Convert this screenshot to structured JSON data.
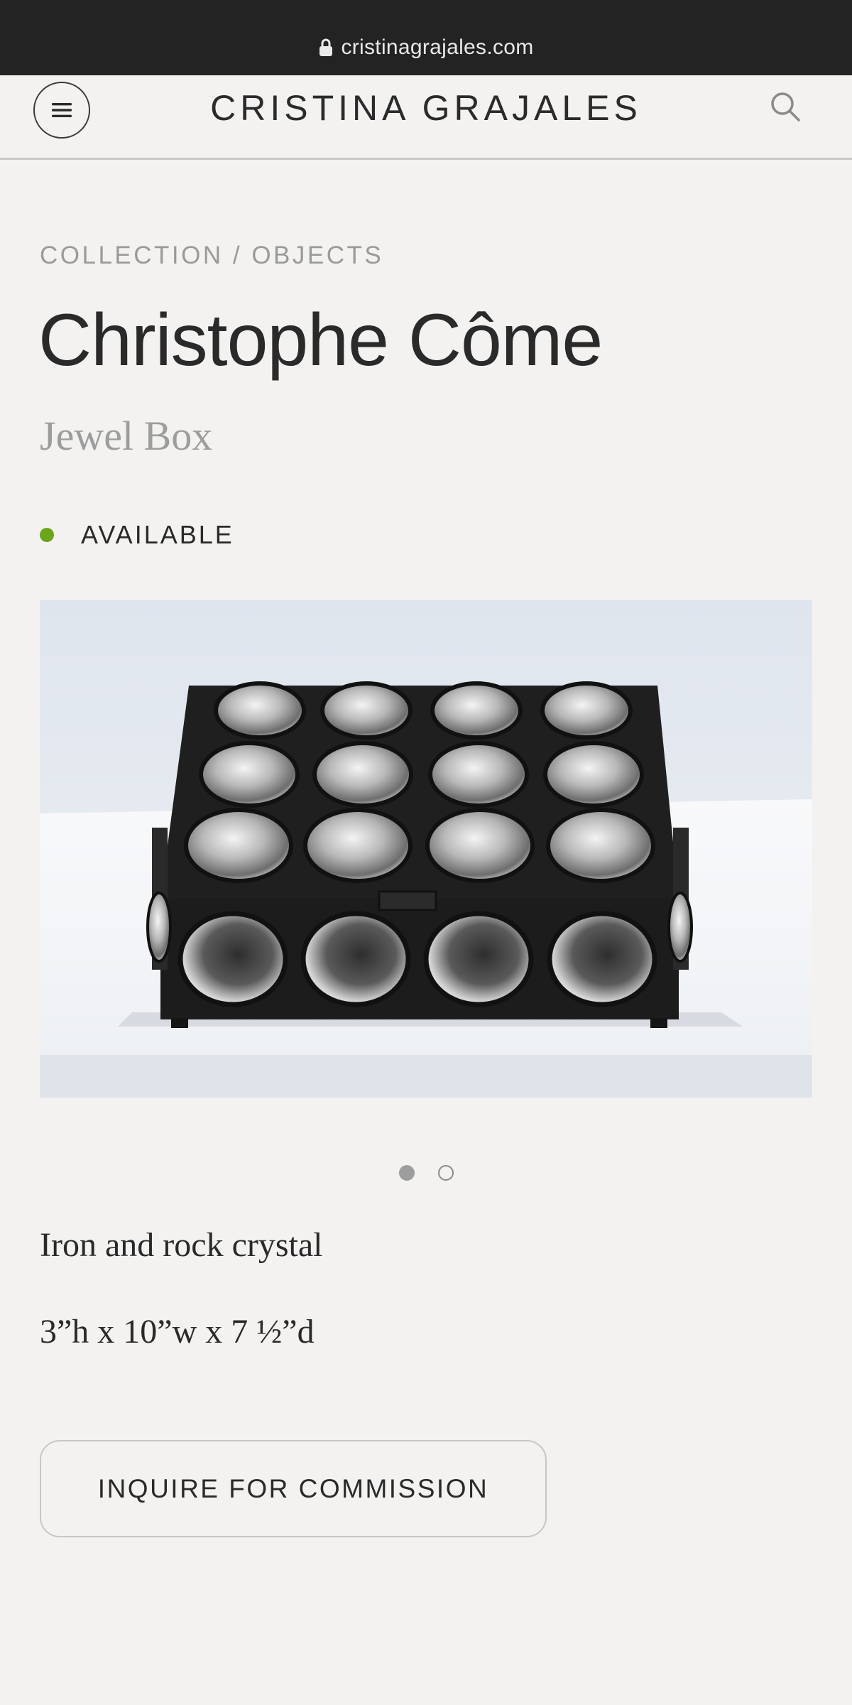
{
  "browser": {
    "url": "cristinagrajales.com"
  },
  "header": {
    "brand": "CRISTINA GRAJALES",
    "menu_icon": "hamburger-menu-icon",
    "search_icon": "search-icon"
  },
  "product": {
    "breadcrumb": "COLLECTION / OBJECTS",
    "designer": "Christophe Côme",
    "name": "Jewel Box",
    "availability": "AVAILABLE",
    "availability_color": "#6aa617",
    "image_alt": "Iron jewel box with rock crystal lenses",
    "carousel": {
      "total": 2,
      "active": 1
    },
    "material": "Iron and rock crystal",
    "dimensions": "3”h x 10”w x 7 ½”d",
    "cta_label": "INQUIRE FOR COMMISSION"
  },
  "colors": {
    "background": "#f3f2f0",
    "status_bar": "#232323",
    "text": "#2a2a2a",
    "muted": "#9a9a9a"
  }
}
